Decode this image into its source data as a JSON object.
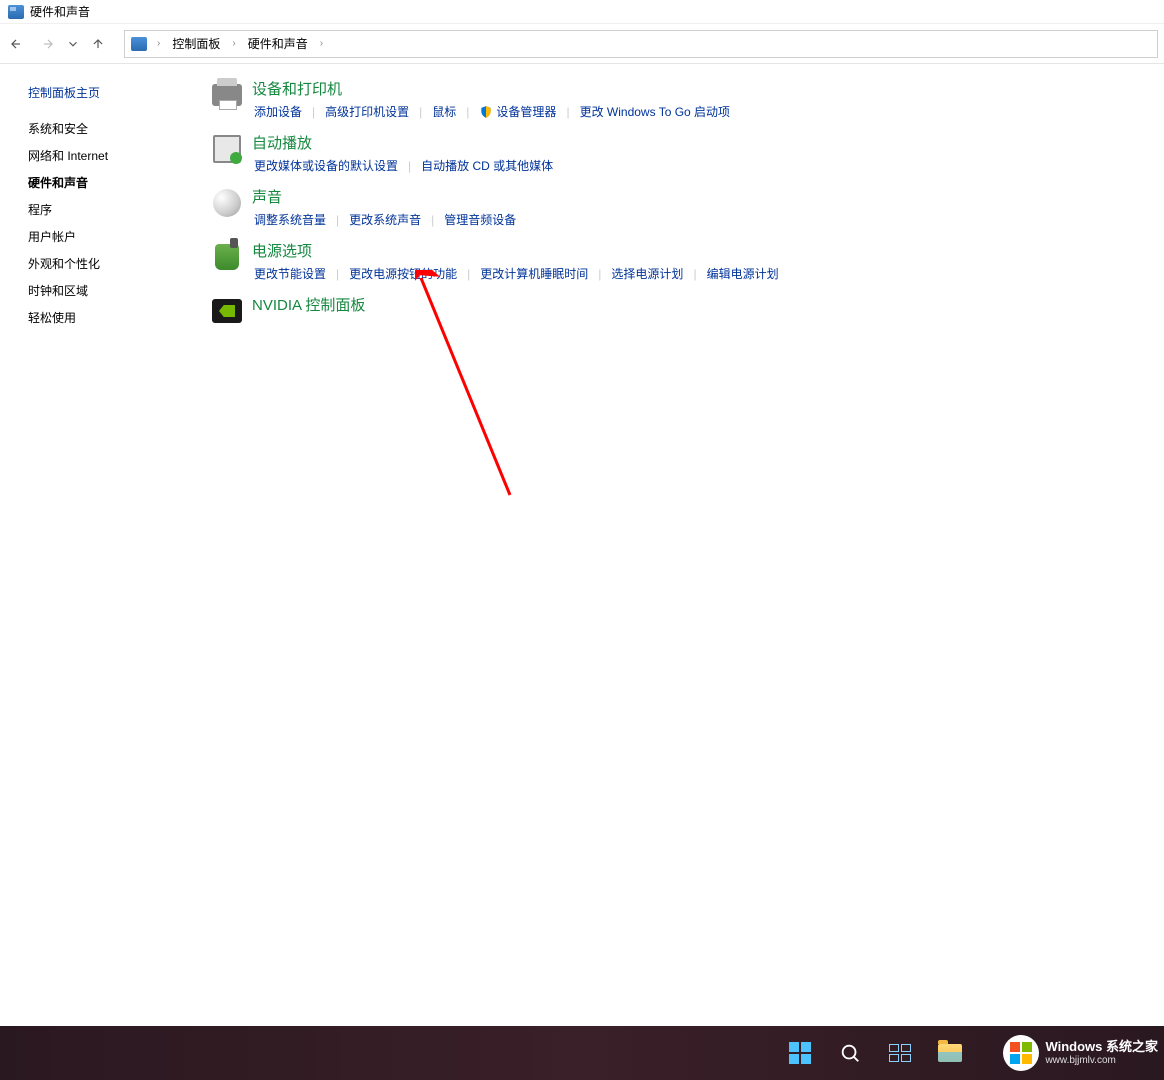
{
  "window": {
    "title": "硬件和声音"
  },
  "breadcrumb": {
    "root": "控制面板",
    "current": "硬件和声音"
  },
  "sidebar": {
    "title": "控制面板主页",
    "items": [
      {
        "label": "系统和安全"
      },
      {
        "label": "网络和 Internet"
      },
      {
        "label": "硬件和声音"
      },
      {
        "label": "程序"
      },
      {
        "label": "用户帐户"
      },
      {
        "label": "外观和个性化"
      },
      {
        "label": "时钟和区域"
      },
      {
        "label": "轻松使用"
      }
    ]
  },
  "categories": {
    "devices": {
      "title": "设备和打印机",
      "links": [
        {
          "label": "添加设备"
        },
        {
          "label": "高级打印机设置"
        },
        {
          "label": "鼠标"
        },
        {
          "label": "设备管理器",
          "shield": true
        },
        {
          "label": "更改 Windows To Go 启动项"
        }
      ]
    },
    "autoplay": {
      "title": "自动播放",
      "links": [
        {
          "label": "更改媒体或设备的默认设置"
        },
        {
          "label": "自动播放 CD 或其他媒体"
        }
      ]
    },
    "sound": {
      "title": "声音",
      "links": [
        {
          "label": "调整系统音量"
        },
        {
          "label": "更改系统声音"
        },
        {
          "label": "管理音频设备"
        }
      ]
    },
    "power": {
      "title": "电源选项",
      "links": [
        {
          "label": "更改节能设置"
        },
        {
          "label": "更改电源按钮的功能"
        },
        {
          "label": "更改计算机睡眠时间"
        },
        {
          "label": "选择电源计划"
        },
        {
          "label": "编辑电源计划"
        }
      ]
    },
    "nvidia": {
      "title": "NVIDIA 控制面板"
    }
  },
  "watermark": {
    "line1": "Windows 系统之家",
    "line2": "www.bjjmlv.com"
  }
}
